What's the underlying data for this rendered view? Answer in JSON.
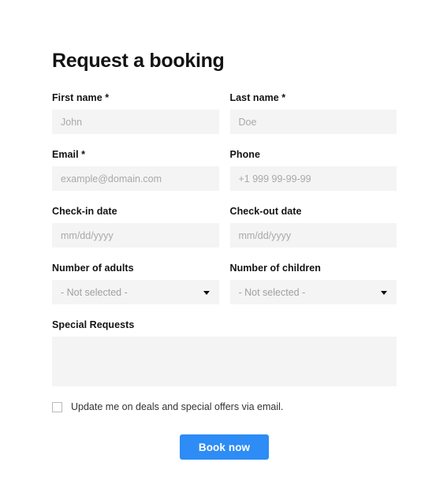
{
  "form": {
    "title": "Request a booking",
    "fields": {
      "first_name": {
        "label": "First name *",
        "placeholder": "John",
        "value": ""
      },
      "last_name": {
        "label": "Last name *",
        "placeholder": "Doe",
        "value": ""
      },
      "email": {
        "label": "Email *",
        "placeholder": "example@domain.com",
        "value": ""
      },
      "phone": {
        "label": "Phone",
        "placeholder": "+1 999 99-99-99",
        "value": ""
      },
      "check_in": {
        "label": "Check-in date",
        "placeholder": "mm/dd/yyyy",
        "value": ""
      },
      "check_out": {
        "label": "Check-out date",
        "placeholder": "mm/dd/yyyy",
        "value": ""
      },
      "adults": {
        "label": "Number of adults",
        "selected": "- Not selected -",
        "arrow_icon": "chevron-down-icon"
      },
      "children": {
        "label": "Number of children",
        "selected": "- Not selected -",
        "arrow_icon": "chevron-down-icon"
      },
      "special_requests": {
        "label": "Special Requests",
        "placeholder": "",
        "value": ""
      }
    },
    "newsletter": {
      "label": "Update me on deals and special offers via email.",
      "checked": false
    },
    "submit": {
      "label": "Book now"
    }
  },
  "colors": {
    "accent": "#2d8cf5",
    "field_background": "#f4f4f4",
    "placeholder_text": "#a9a9a9",
    "label_text": "#131313",
    "page_background": "#ffffff"
  }
}
